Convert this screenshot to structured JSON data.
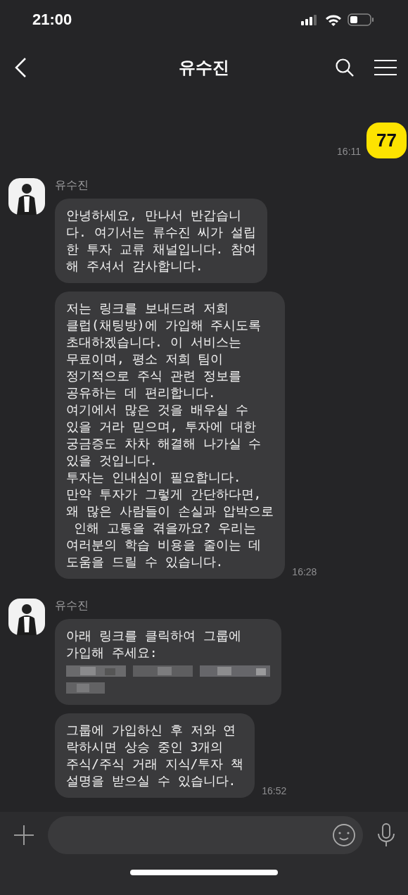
{
  "status_bar": {
    "time": "21:00"
  },
  "header": {
    "title": "유수진"
  },
  "messages": [
    {
      "kind": "outgoing",
      "time": "16:11",
      "bubbles": [
        {
          "text": "77"
        }
      ]
    },
    {
      "kind": "incoming",
      "sender": "유수진",
      "time": "16:28",
      "bubbles": [
        {
          "text": "안녕하세요, 만나서 반갑습니\n다. 여기서는 류수진 씨가 설립\n한 투자 교류 채널입니다. 참여\n해 주셔서 감사합니다."
        },
        {
          "text": "저는 링크를 보내드려 저희\n클럽(채팅방)에 가입해 주시도록\n초대하겠습니다. 이 서비스는\n무료이며, 평소 저희 팀이\n정기적으로 주식 관련 정보를\n공유하는 데 편리합니다.\n여기에서 많은 것을 배우실 수\n있을 거라 믿으며, 투자에 대한\n궁금증도 차차 해결해 나가실 수\n있을 것입니다.\n투자는 인내심이 필요합니다.\n만약 투자가 그렇게 간단하다면,\n왜 많은 사람들이 손실과 압박으로\n 인해 고통을 겪을까요? 우리는\n여러분의 학습 비용을 줄이는 데\n도움을 드릴 수 있습니다."
        }
      ]
    },
    {
      "kind": "incoming",
      "sender": "유수진",
      "time": "16:52",
      "bubbles": [
        {
          "text": "아래 링크를 클릭하여 그룹에\n가입해 주세요:",
          "redacted_link": true
        },
        {
          "text": "그룹에 가입하신 후 저와 연\n락하시면 상승 중인 3개의\n주식/주식 거래 지식/투자 책\n설명을 받으실 수 있습니다."
        }
      ]
    }
  ]
}
